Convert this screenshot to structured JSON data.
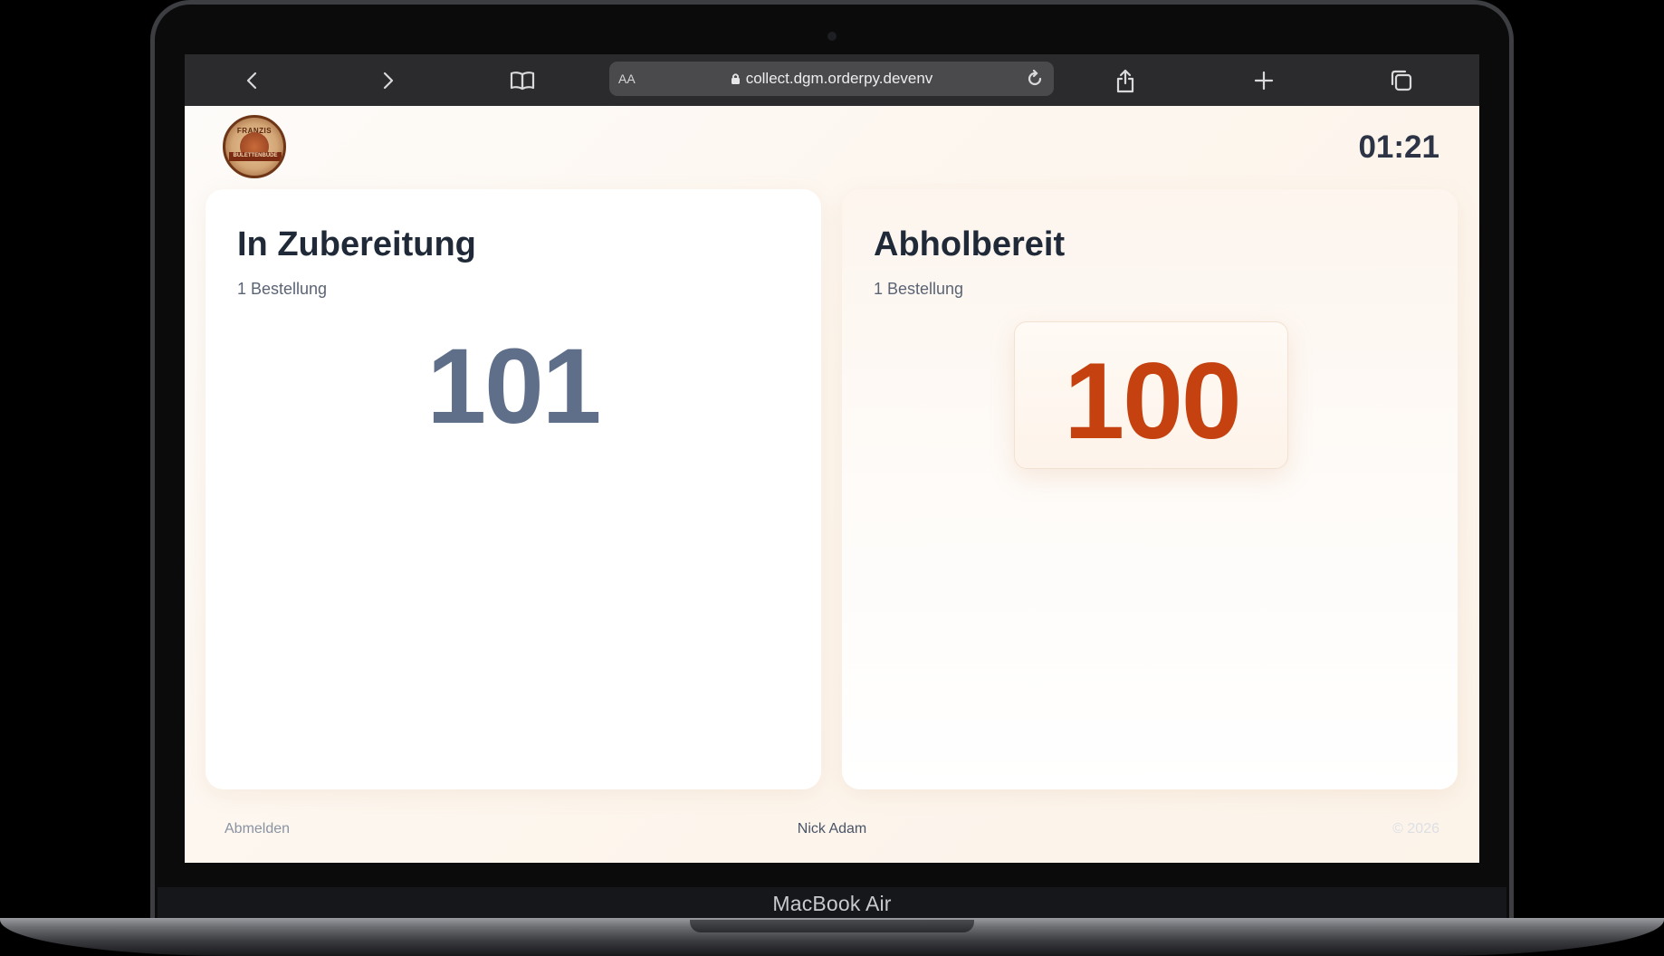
{
  "device": {
    "model_label": "MacBook Air"
  },
  "browser": {
    "url": "collect.dgm.orderpy.devenv",
    "aa_label": "AA",
    "icons": {
      "back": "chevron-left-icon",
      "forward": "chevron-right-icon",
      "bookmarks": "book-icon",
      "lock": "lock-icon",
      "reload": "reload-icon",
      "share": "share-icon",
      "new_tab": "plus-icon",
      "tabs": "tabs-icon"
    }
  },
  "header": {
    "logo_text": "FRANZIS",
    "logo_ribbon": "BULETTENBUDE",
    "clock": "01:21"
  },
  "columns": {
    "preparing": {
      "title": "In Zubereitung",
      "count_label": "1 Bestellung",
      "orders": [
        "101"
      ]
    },
    "ready": {
      "title": "Abholbereit",
      "count_label": "1 Bestellung",
      "orders": [
        "100"
      ]
    }
  },
  "footer": {
    "logout_label": "Abmelden",
    "user_name": "Nick Adam",
    "copyright": "© 2026"
  },
  "colors": {
    "ready_number": "#c5410f",
    "preparing_number": "#5f6f89",
    "toolbar": "#2b2b2d"
  }
}
